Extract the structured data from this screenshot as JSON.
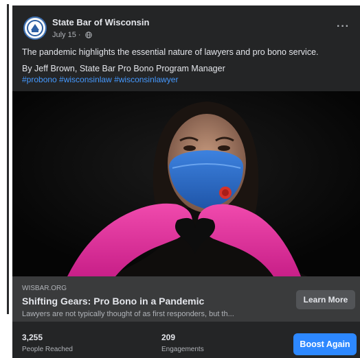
{
  "post": {
    "page_name": "State Bar of Wisconsin",
    "date": "July 15 · ",
    "privacy_icon": "globe-icon",
    "menu_icon": "more-options-icon",
    "text_line1": "The pandemic highlights the essential nature of lawyers and pro bono service.",
    "text_line2": "By Jeff Brown, State Bar Pro Bono Program Manager",
    "hashtags": "#probono #wisconsinlaw #wisconsinlawyer"
  },
  "link_preview": {
    "domain": "WISBAR.ORG",
    "title": "Shifting Gears: Pro Bono in a Pandemic",
    "description": "Lawyers are not typically thought of as first responders, but th...",
    "cta_label": "Learn More"
  },
  "insights": {
    "people_reached_value": "3,255",
    "people_reached_label": "People Reached",
    "engagements_value": "209",
    "engagements_label": "Engagements",
    "boost_label": "Boost Again"
  },
  "colors": {
    "card_bg": "#242526",
    "preview_bg": "#3a3b3c",
    "hashtag": "#4599ff",
    "boost_button": "#2d88ff",
    "mask": "#2f6fc9",
    "gloves": "#e9299d"
  }
}
